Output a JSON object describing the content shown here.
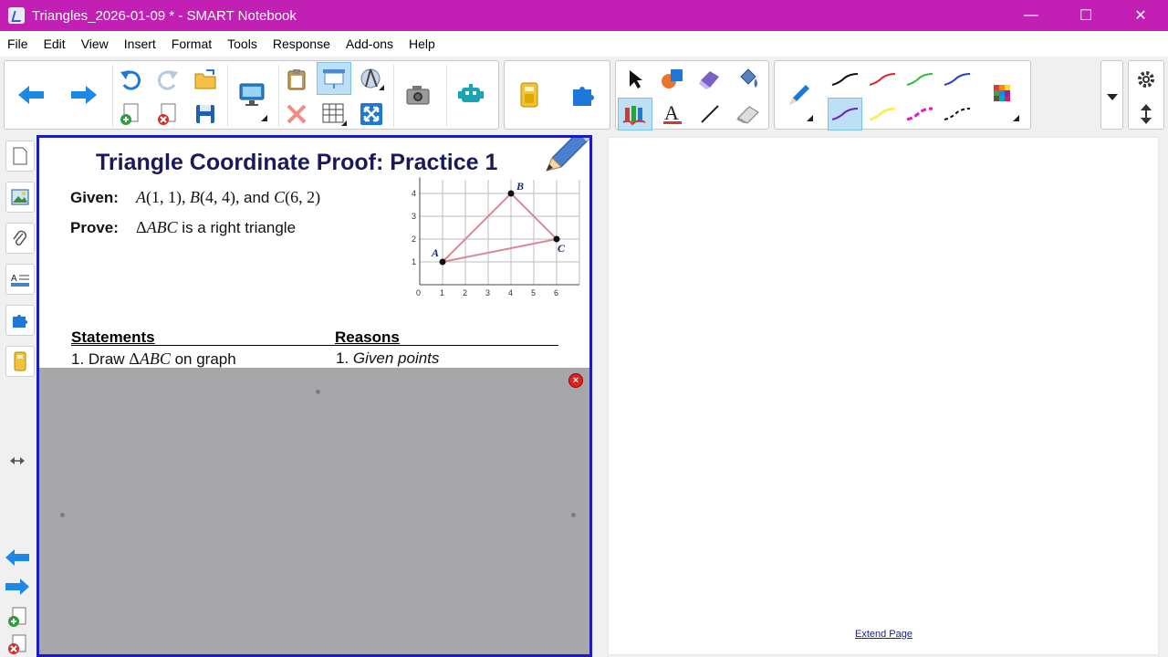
{
  "window": {
    "title": "Triangles_2026-01-09 * - SMART Notebook",
    "minimize": "—",
    "maximize": "☐",
    "close": "✕"
  },
  "menu": [
    "File",
    "Edit",
    "View",
    "Insert",
    "Format",
    "Tools",
    "Response",
    "Add-ons",
    "Help"
  ],
  "colors": {
    "titlebar": "#c21fb5",
    "page_border": "#1b1bbf",
    "triangle": "#d98896",
    "screen_shade": "#a7a6a8"
  },
  "page": {
    "title": "Triangle Coordinate Proof: Practice 1",
    "given_label": "Given:",
    "given_pre_a": "A",
    "given_a": "(1, 1), ",
    "given_b_letter": "B",
    "given_b": "(4, 4), ",
    "given_and": "and ",
    "given_c_letter": "C",
    "given_c": "(6, 2)",
    "prove_label": "Prove:",
    "prove_delta": "Δ",
    "prove_abc": "ABC",
    "prove_text": " is a right triangle",
    "statements_header": "Statements",
    "reasons_header": "Reasons",
    "row1_statement_pre": "1. Draw ",
    "row1_statement_delta": "Δ",
    "row1_statement_abc": "ABC",
    "row1_statement_post": " on graph",
    "row1_reason_num": "1. ",
    "row1_reason": "Given points",
    "shade_close": "×"
  },
  "graph": {
    "x_ticks": [
      "0",
      "1",
      "2",
      "3",
      "4",
      "5",
      "6"
    ],
    "y_ticks": [
      "1",
      "2",
      "3",
      "4"
    ],
    "points": [
      {
        "label": "A",
        "x": 1,
        "y": 1
      },
      {
        "label": "B",
        "x": 4,
        "y": 4
      },
      {
        "label": "C",
        "x": 6,
        "y": 2
      }
    ]
  },
  "page2": {
    "extend_link": "Extend Page"
  }
}
